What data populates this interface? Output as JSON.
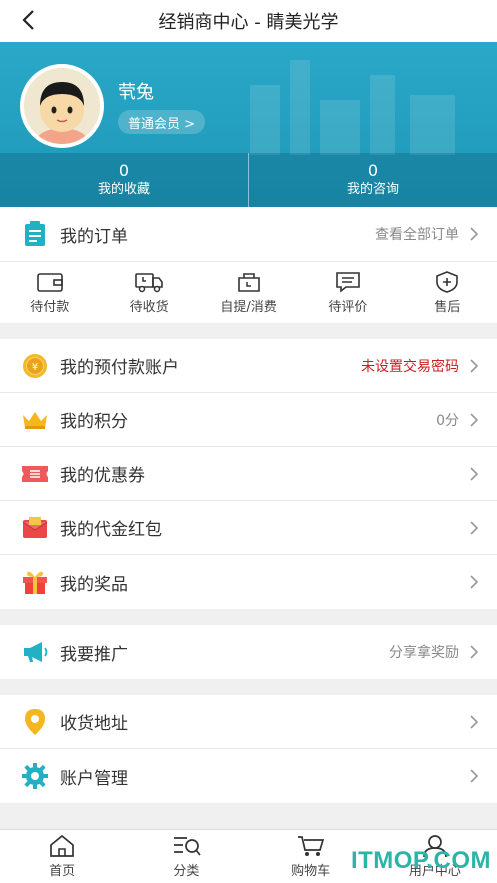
{
  "header": {
    "title": "经销商中心 - 睛美光学"
  },
  "profile": {
    "name": "茕兔",
    "member_label": "普通会员 >"
  },
  "stats": [
    {
      "num": "0",
      "label": "我的收藏"
    },
    {
      "num": "0",
      "label": "我的咨询"
    }
  ],
  "orders": {
    "title": "我的订单",
    "view_all": "查看全部订单",
    "statuses": [
      {
        "label": "待付款",
        "icon": "wallet-icon"
      },
      {
        "label": "待收货",
        "icon": "truck-icon"
      },
      {
        "label": "自提/消费",
        "icon": "store-icon"
      },
      {
        "label": "待评价",
        "icon": "comment-icon"
      },
      {
        "label": "售后",
        "icon": "shield-icon"
      }
    ]
  },
  "account": {
    "prepay": {
      "label": "我的预付款账户",
      "right": "未设置交易密码"
    },
    "points": {
      "label": "我的积分",
      "right": "0分"
    },
    "coupons": {
      "label": "我的优惠券"
    },
    "redpacket": {
      "label": "我的代金红包"
    },
    "prizes": {
      "label": "我的奖品"
    }
  },
  "promote": {
    "label": "我要推广",
    "right": "分享拿奖励"
  },
  "settings": {
    "address": {
      "label": "收货地址"
    },
    "manage": {
      "label": "账户管理"
    }
  },
  "nav": [
    {
      "label": "首页",
      "icon": "home-icon"
    },
    {
      "label": "分类",
      "icon": "category-search-icon"
    },
    {
      "label": "购物车",
      "icon": "cart-icon"
    },
    {
      "label": "用户中心",
      "icon": "user-icon"
    }
  ],
  "watermark": "ITMOP.COM",
  "colors": {
    "accent": "#2aa8c7",
    "warning": "#c81e1e",
    "teal": "#21b0c4"
  }
}
